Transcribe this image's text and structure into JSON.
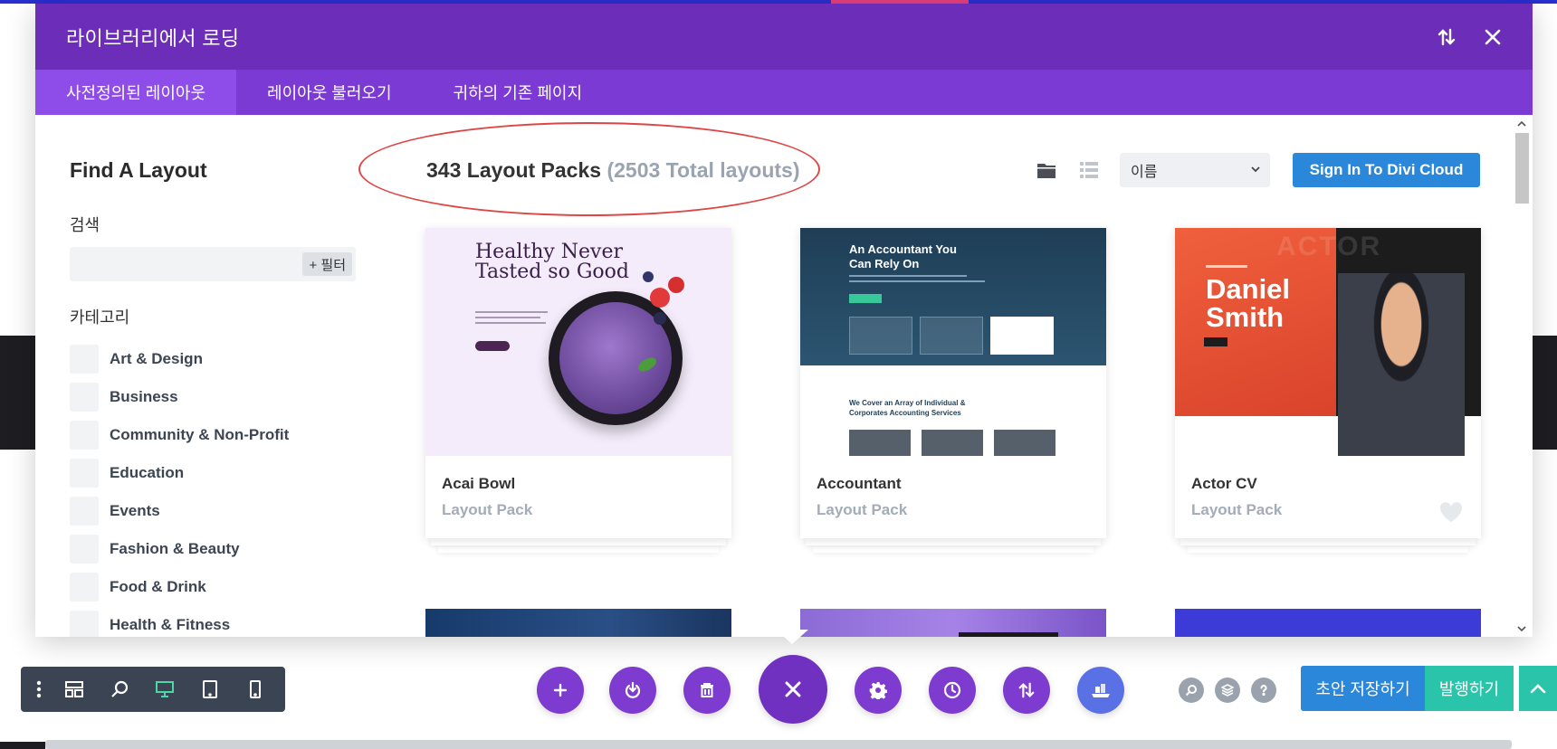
{
  "modal": {
    "title": "라이브러리에서 로딩",
    "tabs": [
      {
        "label": "사전정의된 레이아웃"
      },
      {
        "label": "레이아웃 불러오기"
      },
      {
        "label": "귀하의 기존 페이지"
      }
    ]
  },
  "sidebar": {
    "find_title": "Find A Layout",
    "search_label": "검색",
    "search_value": "",
    "filter_label": "+ 필터",
    "category_label": "카테고리",
    "categories": [
      "Art & Design",
      "Business",
      "Community & Non-Profit",
      "Education",
      "Events",
      "Fashion & Beauty",
      "Food & Drink",
      "Health & Fitness"
    ]
  },
  "main": {
    "pack_count": "343 Layout Packs",
    "total_layouts": "(2503 Total layouts)",
    "sort_value": "이름",
    "signin_label": "Sign In To Divi Cloud",
    "cards": [
      {
        "title": "Acai Bowl",
        "subtitle": "Layout Pack",
        "thumb_heading": "Healthy Never Tasted so Good"
      },
      {
        "title": "Accountant",
        "subtitle": "Layout Pack",
        "thumb_heading": "An Accountant You Can Rely On",
        "thumb_heading2": "We Cover an Array of Individual & Corporates Accounting Services"
      },
      {
        "title": "Actor CV",
        "subtitle": "Layout Pack",
        "thumb_heading": "Daniel Smith",
        "thumb_word": "ACTOR"
      }
    ]
  },
  "toolbar": {
    "draft_label": "초안 저장하기",
    "publish_label": "발행하기"
  },
  "colors": {
    "header": "#6c2eb9",
    "tabs": "#7b3ad3",
    "tab_active": "#8e4de9",
    "primary_blue": "#2b87da",
    "publish_green": "#29c4a9",
    "circle_purple": "#7e3bd0"
  }
}
